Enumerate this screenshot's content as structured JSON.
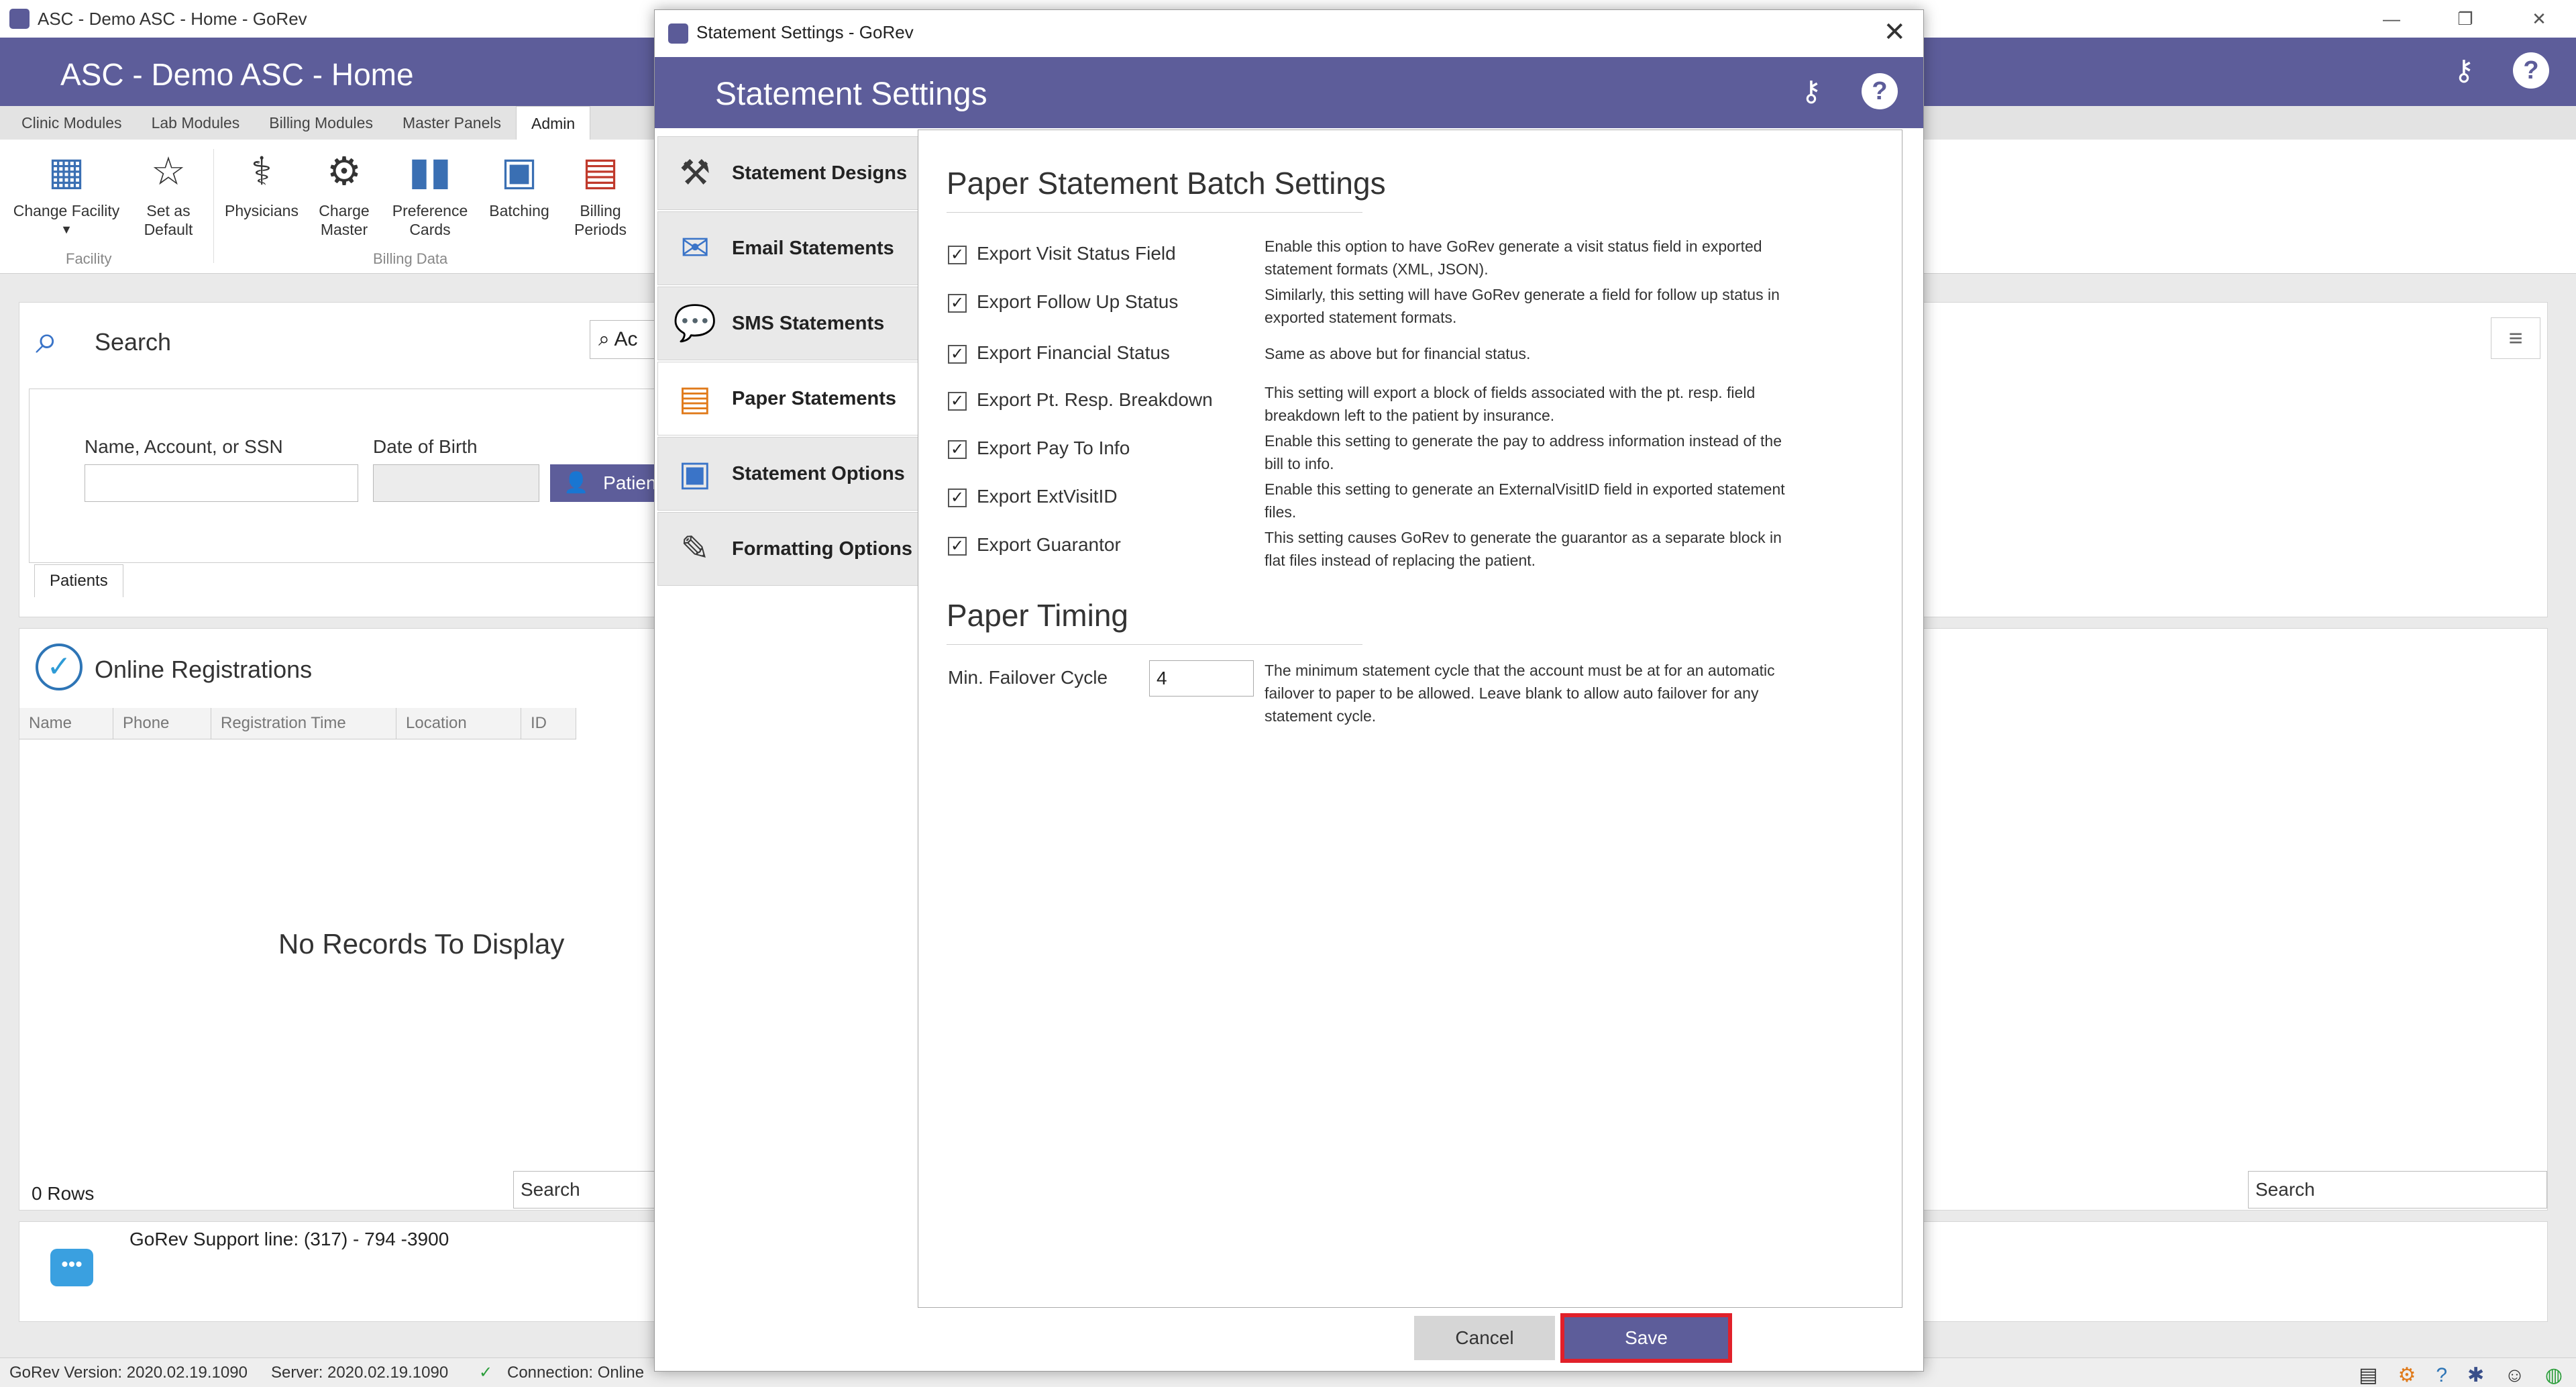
{
  "app": {
    "title": "ASC - Demo ASC - Home - GoRev",
    "header_title": "ASC - Demo ASC - Home",
    "win_controls": [
      "—",
      "❐",
      "✕"
    ]
  },
  "ribbon": {
    "tabs": [
      "Clinic Modules",
      "Lab Modules",
      "Billing Modules",
      "Master Panels",
      "Admin"
    ],
    "buttons": {
      "change_facility": "Change Facility",
      "set_as_default_1": "Set as",
      "set_as_default_2": "Default",
      "physicians": "Physicians",
      "charge_master_1": "Charge",
      "charge_master_2": "Master",
      "preference_cards_1": "Preference",
      "preference_cards_2": "Cards",
      "batching": "Batching",
      "billing_periods_1": "Billing",
      "billing_periods_2": "Periods"
    },
    "groups": {
      "facility": "Facility",
      "billing_data": "Billing Data"
    }
  },
  "search_panel": {
    "title": "Search",
    "name_label": "Name, Account, or SSN",
    "dob_label": "Date of Birth",
    "patient_button": "Patient",
    "tab": "Patients",
    "search_field_fragment": "Ac"
  },
  "registrations": {
    "title": "Online Registrations",
    "columns": [
      "Name",
      "Phone",
      "Registration Time",
      "Location",
      "ID"
    ],
    "empty": "No Records To Display",
    "rows": "0 Rows",
    "search": "Search",
    "right_search": "Search"
  },
  "support": {
    "text": "GoRev Support line: (317) - 794 -3900"
  },
  "statusbar": {
    "version": "GoRev Version: 2020.02.19.1090",
    "server": "Server: 2020.02.19.1090",
    "connection": "Connection: Online"
  },
  "modal": {
    "window_title": "Statement Settings - GoRev",
    "header_title": "Statement Settings",
    "nav": [
      {
        "label": "Statement Designs"
      },
      {
        "label": "Email Statements"
      },
      {
        "label": "SMS Statements"
      },
      {
        "label": "Paper Statements"
      },
      {
        "label": "Statement Options"
      },
      {
        "label": "Formatting Options"
      }
    ],
    "batch_title": "Paper Statement Batch Settings",
    "options": [
      {
        "label": "Export Visit Status Field",
        "checked": true,
        "desc": "Enable this option to have GoRev generate a visit status field in exported statement formats (XML, JSON)."
      },
      {
        "label": "Export Follow Up Status",
        "checked": true,
        "desc": "Similarly, this setting will have GoRev generate a field for follow up status in exported statement formats."
      },
      {
        "label": "Export Financial Status",
        "checked": true,
        "desc": "Same as above but for financial status."
      },
      {
        "label": "Export Pt. Resp. Breakdown",
        "checked": true,
        "desc": "This setting will export a block of fields associated with the pt. resp. field breakdown left to the patient by insurance."
      },
      {
        "label": "Export Pay To Info",
        "checked": true,
        "desc": "Enable this setting to generate the pay to address information instead of the bill to info."
      },
      {
        "label": "Export ExtVisitID",
        "checked": true,
        "desc": "Enable this setting to generate an ExternalVisitID field in exported statement files."
      },
      {
        "label": "Export Guarantor",
        "checked": true,
        "desc": "This setting causes GoRev to generate the guarantor as a separate block in flat files instead of replacing the patient."
      }
    ],
    "timing_title": "Paper Timing",
    "failover_label": "Min. Failover Cycle",
    "failover_value": "4",
    "failover_desc": "The minimum statement cycle that the account must be at for an automatic failover to paper to be allowed. Leave blank to allow auto failover for any statement cycle.",
    "cancel": "Cancel",
    "save": "Save",
    "check_glyph": "✓",
    "close_glyph": "✕",
    "help_glyph": "?"
  }
}
